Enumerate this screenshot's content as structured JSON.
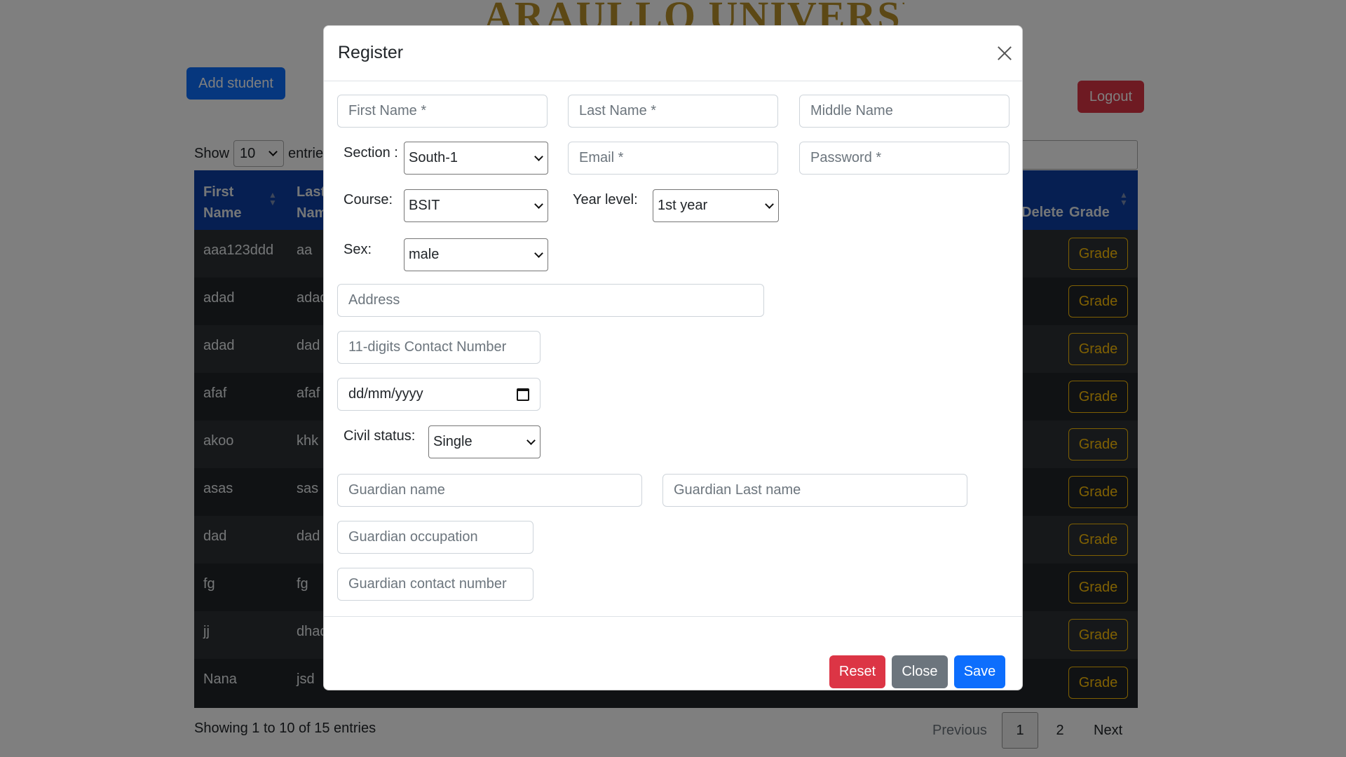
{
  "background": {
    "site_title": "ARAULLO UNIVERSITY",
    "add_student_label": "Add student",
    "logout_label": "Logout",
    "show_label": "Show",
    "length_value": "10",
    "entries_label": "entries",
    "table": {
      "headers": {
        "first_name": "First Name",
        "last_name": "Last Name",
        "delete": "Delete",
        "grade": "Grade"
      },
      "rows": [
        {
          "first": "aaa123ddd",
          "last": "aa",
          "grade_label": "Grade"
        },
        {
          "first": "adad",
          "last": "adad",
          "grade_label": "Grade"
        },
        {
          "first": "adad",
          "last": "dad",
          "grade_label": "Grade"
        },
        {
          "first": "afaf",
          "last": "afaf",
          "grade_label": "Grade"
        },
        {
          "first": "akoo",
          "last": "khk",
          "grade_label": "Grade"
        },
        {
          "first": "asas",
          "last": "sas",
          "grade_label": "Grade"
        },
        {
          "first": "dad",
          "last": "dad",
          "grade_label": "Grade"
        },
        {
          "first": "fg",
          "last": "fg",
          "grade_label": "Grade"
        },
        {
          "first": "jj",
          "last": "dhad",
          "grade_label": "Grade"
        },
        {
          "first": "Nana",
          "last": "jsd",
          "grade_label": "Grade"
        }
      ]
    },
    "info_text": "Showing 1 to 10 of 15 entries",
    "pagination": {
      "previous": "Previous",
      "page1": "1",
      "page2": "2",
      "next": "Next"
    }
  },
  "modal": {
    "title": "Register",
    "placeholders": {
      "first_name": "First Name *",
      "last_name": "Last Name *",
      "middle_name": "Middle Name",
      "email": "Email *",
      "password": "Password *",
      "address": "Address",
      "contact": "11-digits Contact Number",
      "birthdate": "dd/mm/yyyy",
      "guardian_name": "Guardian name",
      "guardian_last_name": "Guardian Last name",
      "guardian_occupation": "Guardian occupation",
      "guardian_contact": "Guardian contact number"
    },
    "labels": {
      "section": "Section :",
      "course": "Course:",
      "year_level": "Year level:",
      "sex": "Sex:",
      "civil_status": "Civil status:"
    },
    "selects": {
      "section": "South-1",
      "course": "BSIT",
      "year_level": "1st year",
      "sex": "male",
      "civil_status": "Single"
    },
    "buttons": {
      "reset": "Reset",
      "close": "Close",
      "save": "Save"
    }
  }
}
